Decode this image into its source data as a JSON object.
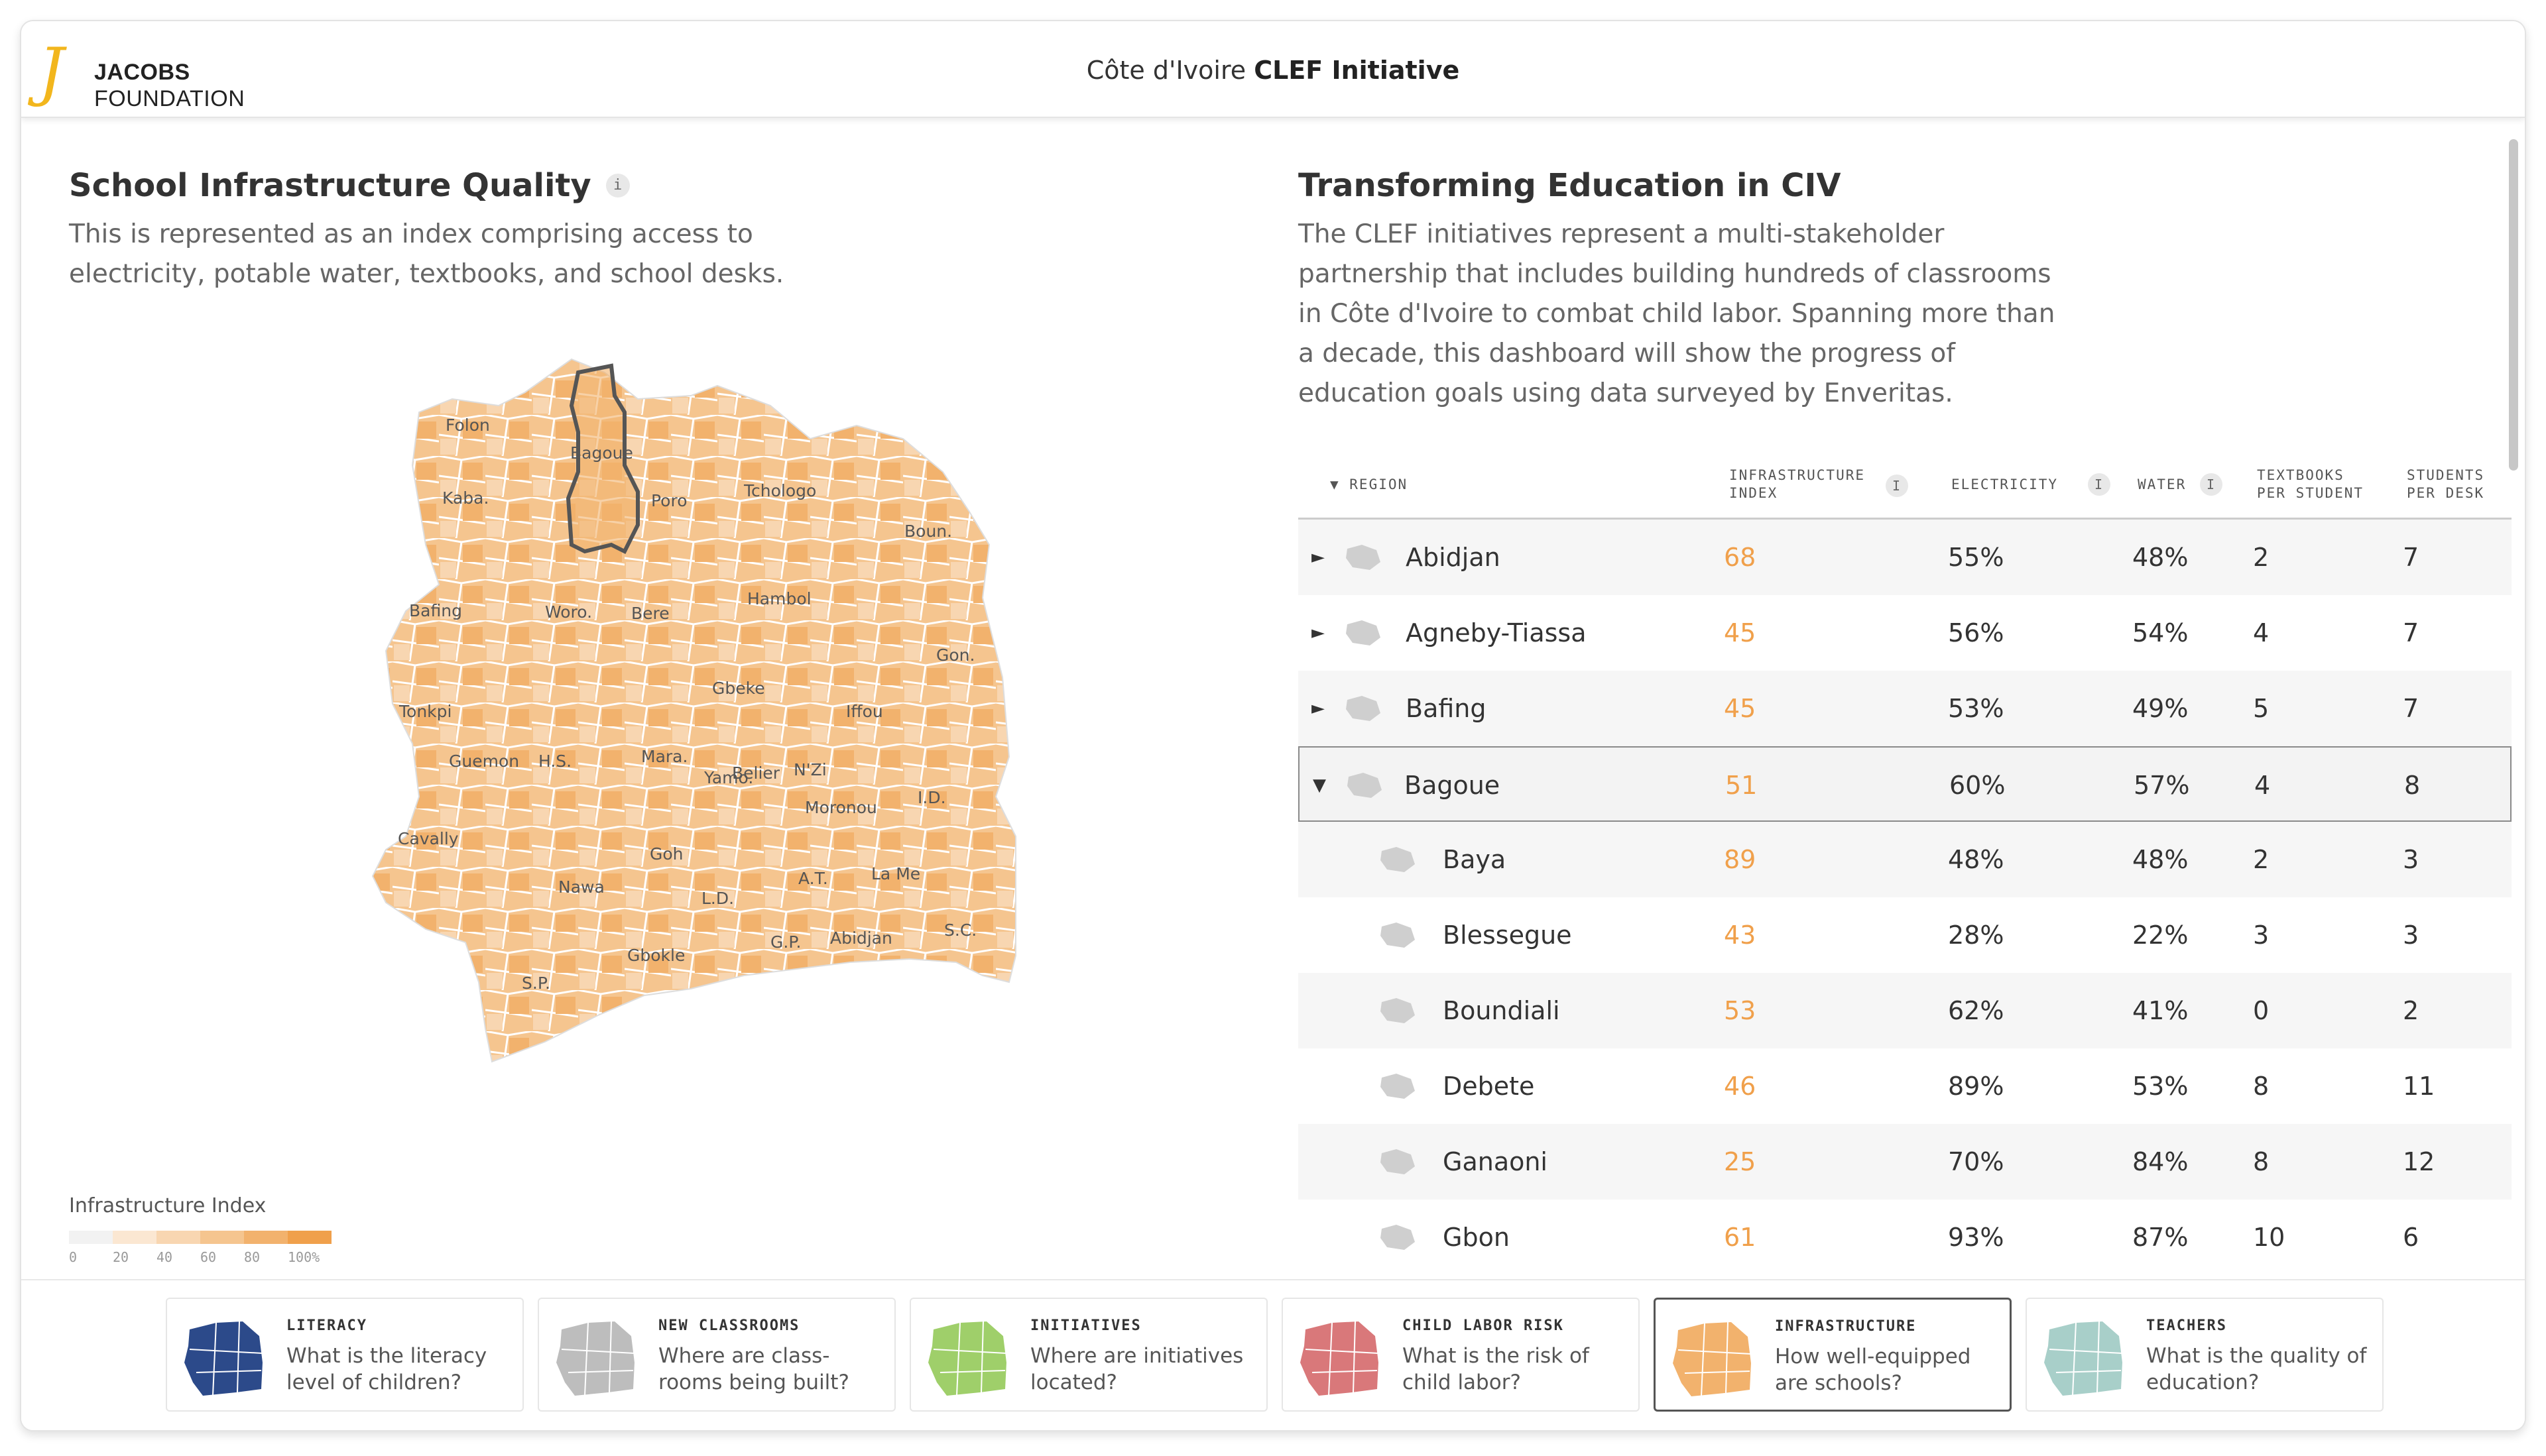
{
  "header": {
    "logo_top": "JACOBS",
    "logo_bottom": "FOUNDATION",
    "title_prefix": "Côte d'Ivoire",
    "title_bold": "CLEF Initiative"
  },
  "left_panel": {
    "title": "School Infrastructure Quality",
    "info_icon": "i",
    "description": "This is represented as an index comprising access to electricity, potable water, textbooks, and school desks.",
    "map_labels": [
      "Folon",
      "Bagoue",
      "Kaba.",
      "Poro",
      "Tchologo",
      "Boun.",
      "Hambol",
      "Bafing",
      "Woro.",
      "Bere",
      "Gon.",
      "Gbeke",
      "Tonkpi",
      "Iffou",
      "Guemon",
      "H.S.",
      "Mara.",
      "Yamo.",
      "Belier",
      "N'Zi",
      "Moronou",
      "I.D.",
      "Cavally",
      "Goh",
      "A.T.",
      "La Me",
      "Nawa",
      "L.D.",
      "G.P.",
      "Abidjan",
      "S.C.",
      "Gbokle",
      "S.P."
    ],
    "legend": {
      "title": "Infrastructure Index",
      "ticks": [
        "0",
        "20",
        "40",
        "60",
        "80",
        "100%"
      ],
      "colors": [
        "#f2f2f2",
        "#fbe7d2",
        "#f8d6b1",
        "#f5c58f",
        "#f2b26d",
        "#f0a04b"
      ]
    }
  },
  "right_panel": {
    "title": "Transforming Education in CIV",
    "description": "The CLEF initiatives represent a multi-stakeholder partnership that includes building hundreds of classrooms in Côte d'Ivoire to combat child labor. Spanning more than a decade, this dashboard will show the progress of education goals using data surveyed by Enveritas."
  },
  "table": {
    "headers": {
      "region": "▼ REGION",
      "index_1": "INFRASTRUCTURE",
      "index_2": "INDEX",
      "electricity": "ELECTRICITY",
      "water": "WATER",
      "textbooks_1": "TEXTBOOKS",
      "textbooks_2": "PER STUDENT",
      "students_1": "STUDENTS",
      "students_2": "PER DESK",
      "info": "i"
    },
    "rows": [
      {
        "arrow": "►",
        "name": "Abidjan",
        "index": "68",
        "electricity": "55%",
        "water": "48%",
        "textbooks": "2",
        "students": "7"
      },
      {
        "arrow": "►",
        "name": "Agneby-Tiassa",
        "index": "45",
        "electricity": "56%",
        "water": "54%",
        "textbooks": "4",
        "students": "7"
      },
      {
        "arrow": "►",
        "name": "Bafing",
        "index": "45",
        "electricity": "53%",
        "water": "49%",
        "textbooks": "5",
        "students": "7"
      },
      {
        "arrow": "▼",
        "name": "Bagoue",
        "index": "51",
        "electricity": "60%",
        "water": "57%",
        "textbooks": "4",
        "students": "8"
      },
      {
        "arrow": "",
        "name": "Baya",
        "index": "89",
        "electricity": "48%",
        "water": "48%",
        "textbooks": "2",
        "students": "3"
      },
      {
        "arrow": "",
        "name": "Blessegue",
        "index": "43",
        "electricity": "28%",
        "water": "22%",
        "textbooks": "3",
        "students": "3"
      },
      {
        "arrow": "",
        "name": "Boundiali",
        "index": "53",
        "electricity": "62%",
        "water": "41%",
        "textbooks": "0",
        "students": "2"
      },
      {
        "arrow": "",
        "name": "Debete",
        "index": "46",
        "electricity": "89%",
        "water": "53%",
        "textbooks": "8",
        "students": "11"
      },
      {
        "arrow": "",
        "name": "Ganaoni",
        "index": "25",
        "electricity": "70%",
        "water": "84%",
        "textbooks": "8",
        "students": "12"
      },
      {
        "arrow": "",
        "name": "Gbon",
        "index": "61",
        "electricity": "93%",
        "water": "87%",
        "textbooks": "10",
        "students": "6"
      }
    ]
  },
  "footer": {
    "cards": [
      {
        "title": "LITERACY",
        "question": "What is the literacy level of children?",
        "color": "#2c4a8a"
      },
      {
        "title": "NEW CLASSROOMS",
        "question": "Where are class-rooms being built?",
        "color": "#bdbdbd"
      },
      {
        "title": "INITIATIVES",
        "question": "Where are initiatives located?",
        "color": "#9fcf6a"
      },
      {
        "title": "CHILD LABOR RISK",
        "question": "What is the risk of child labor?",
        "color": "#d9787a"
      },
      {
        "title": "INFRASTRUCTURE",
        "question": "How well-equipped are schools?",
        "color": "#f2b26d"
      },
      {
        "title": "TEACHERS",
        "question": "What is the quality of education?",
        "color": "#a8cfc9"
      }
    ]
  }
}
